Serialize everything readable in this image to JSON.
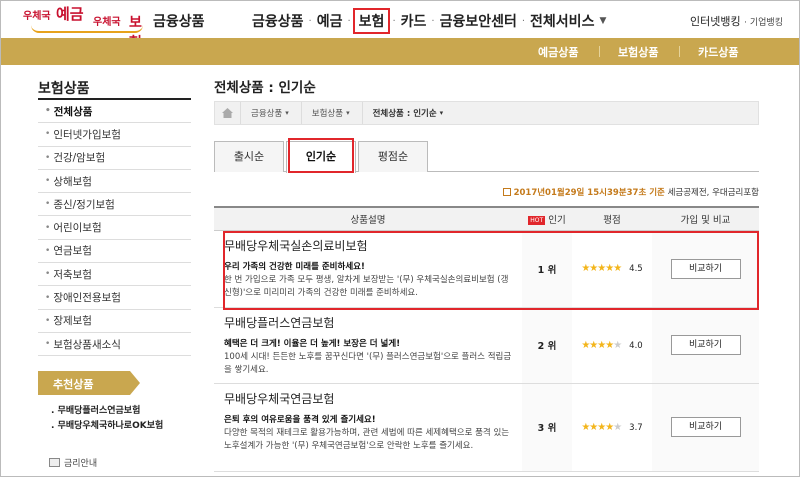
{
  "header": {
    "logo": {
      "post": "우체국",
      "yegeum": "예금",
      "post2": "우체국",
      "bohum": "보험"
    },
    "brand_label": "금융상품",
    "gnb": [
      {
        "label": "금융상품"
      },
      {
        "label": "예금"
      },
      {
        "label": "보험"
      },
      {
        "label": "카드"
      },
      {
        "label": "금융보안센터"
      },
      {
        "label": "전체서비스"
      }
    ],
    "util": {
      "internet": "인터넷뱅킹",
      "corp": "기업뱅킹"
    }
  },
  "subnav": {
    "items": [
      "예금상품",
      "보험상품",
      "카드상품"
    ]
  },
  "lnb": {
    "title": "보험상품",
    "items": [
      "전체상품",
      "인터넷가입보험",
      "건강/암보험",
      "상해보험",
      "종신/정기보험",
      "어린이보험",
      "연금보험",
      "저축보험",
      "장애인전용보험",
      "장제보험",
      "보험상품새소식"
    ],
    "recommend_title": "추천상품",
    "recommend_items": [
      "무배당플러스연금보험",
      "무배당우체국하나로OK보험"
    ],
    "rate_info": "금리안내"
  },
  "main": {
    "title": "전체상품 : 인기순",
    "breadcrumb": [
      "금융상품",
      "보험상품",
      "전체상품 : 인기순"
    ],
    "tabs": [
      "출시순",
      "인기순",
      "평점순"
    ],
    "timestamp": "2017년01월29일 15시39분37초 기준",
    "timestamp_note": "세금공제전, 우대금리포함",
    "table": {
      "headers": {
        "desc": "상품설명",
        "hot": "HOT",
        "rank": "인기",
        "score": "평점",
        "action": "가입 및 비교"
      },
      "rows": [
        {
          "name": "무배당우체국실손의료비보험",
          "tagline": "우리 가족의 건강한 미래를 준비하세요!",
          "desc": "한 번 가입으로 가족 모두 평생, 알차게 보장받는 '(무) 우체국실손의료비보험 (갱신형)'으로 미리미리 가족의 건강한 미래를 준비하세요.",
          "rank": "1 위",
          "stars": 4.5,
          "score": "4.5",
          "button": "비교하기"
        },
        {
          "name": "무배당플러스연금보험",
          "tagline": "혜택은 더 크게! 이율은 더 높게! 보장은 더 넓게!",
          "desc": "100세 시대! 든든한 노후를 꿈꾸신다면 '(무) 플러스연금보험'으로 플러스 적립금을 쌓기세요.",
          "rank": "2 위",
          "stars": 4.0,
          "score": "4.0",
          "button": "비교하기"
        },
        {
          "name": "무배당우체국연금보험",
          "tagline": "은퇴 후의 여유로움을 품격 있게 즐기세요!",
          "desc": "다양한 목적의 재테크로 활용가능하며, 관련 세법에 따른 세제혜택으로 품격 있는 노후설계가 가능한 '(무) 우체국연금보험'으로 안락한 노후를 즐기세요.",
          "rank": "3 위",
          "stars": 3.7,
          "score": "3.7",
          "button": "비교하기"
        }
      ]
    }
  },
  "colors": {
    "gold": "#c9a74f",
    "red": "#e1262b",
    "star": "#f3b51b"
  }
}
